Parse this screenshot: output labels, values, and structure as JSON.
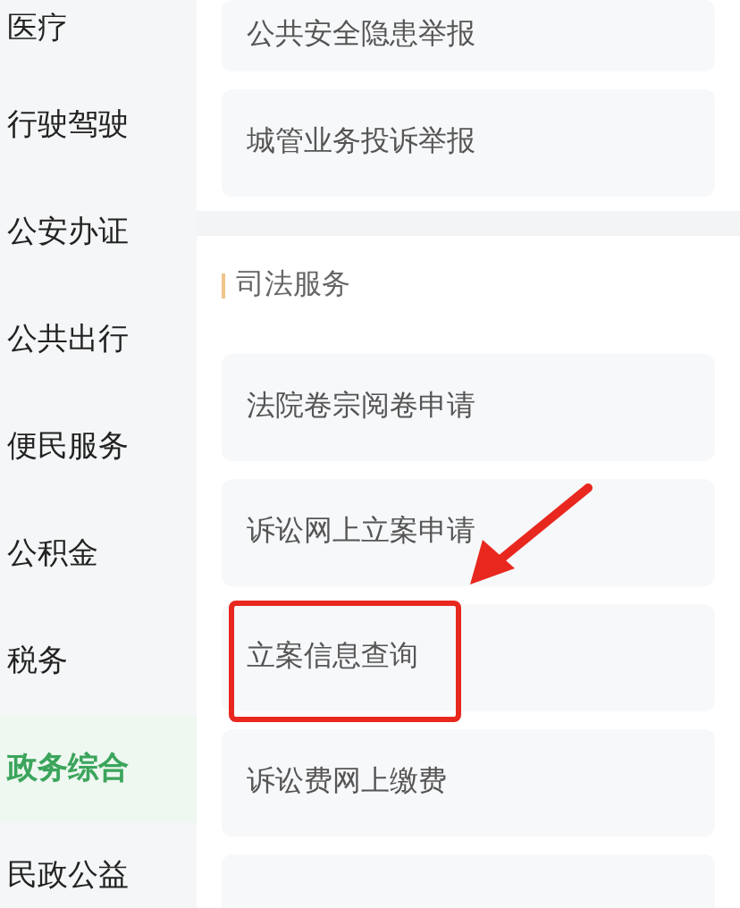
{
  "sidebar": {
    "items": [
      {
        "label": "医疗",
        "selected": false
      },
      {
        "label": "行驶驾驶",
        "selected": false
      },
      {
        "label": "公安办证",
        "selected": false
      },
      {
        "label": "公共出行",
        "selected": false
      },
      {
        "label": "便民服务",
        "selected": false
      },
      {
        "label": "公积金",
        "selected": false
      },
      {
        "label": "税务",
        "selected": false
      },
      {
        "label": "政务综合",
        "selected": true
      },
      {
        "label": "民政公益",
        "selected": false
      }
    ]
  },
  "sections": [
    {
      "items": [
        {
          "label": "公共安全隐患举报",
          "circled": false
        },
        {
          "label": "城管业务投诉举报",
          "circled": false
        }
      ]
    },
    {
      "title": "司法服务",
      "items": [
        {
          "label": "法院卷宗阅卷申请",
          "circled": false
        },
        {
          "label": "诉讼网上立案申请",
          "circled": false
        },
        {
          "label": "立案信息查询",
          "circled": true
        },
        {
          "label": "诉讼费网上缴费",
          "circled": false
        }
      ]
    }
  ],
  "annotation_arrow": true
}
